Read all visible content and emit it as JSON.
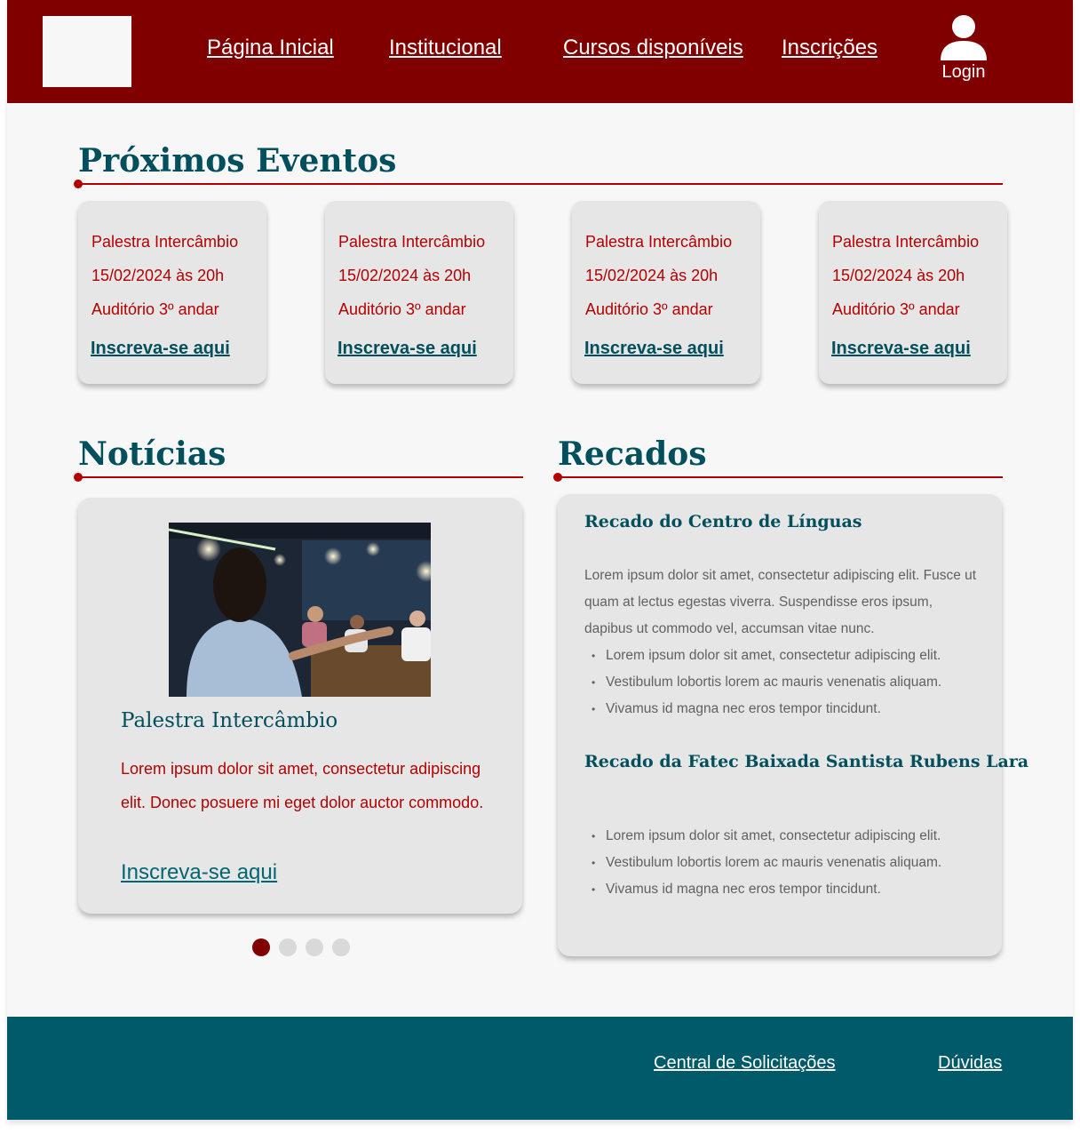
{
  "header": {
    "nav": [
      {
        "label": "Página Inicial"
      },
      {
        "label": "Institucional"
      },
      {
        "label": "Cursos disponíveis"
      },
      {
        "label": "Inscrições"
      }
    ],
    "login_label": "Login"
  },
  "events": {
    "title": "Próximos Eventos",
    "cards": [
      {
        "name": "Palestra Intercâmbio",
        "date": "15/02/2024 às 20h",
        "place": "Auditório 3º andar",
        "link": "Inscreva-se aqui"
      },
      {
        "name": "Palestra Intercâmbio",
        "date": "15/02/2024 às 20h",
        "place": "Auditório 3º andar",
        "link": "Inscreva-se aqui"
      },
      {
        "name": "Palestra Intercâmbio",
        "date": "15/02/2024 às 20h",
        "place": "Auditório 3º andar",
        "link": "Inscreva-se aqui"
      },
      {
        "name": "Palestra Intercâmbio",
        "date": "15/02/2024 às 20h",
        "place": "Auditório 3º andar",
        "link": "Inscreva-se aqui"
      }
    ]
  },
  "news": {
    "title": "Notícias",
    "item": {
      "headline": "Palestra Intercâmbio",
      "text": "Lorem ipsum dolor sit amet, consectetur adipiscing elit. Donec posuere mi eget dolor auctor commodo.",
      "link": "Inscreva-se aqui"
    },
    "carousel": {
      "count": 4,
      "active": 1
    }
  },
  "recados": {
    "title": "Recados",
    "items": [
      {
        "title": "Recado do Centro de Línguas",
        "text": "Lorem ipsum dolor sit amet, consectetur adipiscing elit. Fusce ut quam at lectus egestas viverra. Suspendisse eros ipsum, dapibus ut commodo vel, accumsan vitae nunc.",
        "bullets": [
          "Lorem ipsum dolor sit amet, consectetur adipiscing elit.",
          "Vestibulum lobortis lorem ac mauris venenatis aliquam.",
          "Vivamus id magna nec eros tempor tincidunt."
        ]
      },
      {
        "title": "Recado da Fatec Baixada Santista Rubens Lara",
        "text": "",
        "bullets": [
          "Lorem ipsum dolor sit amet, consectetur adipiscing elit.",
          "Vestibulum lobortis lorem ac mauris venenatis aliquam.",
          "Vivamus id magna nec eros tempor tincidunt."
        ]
      }
    ]
  },
  "footer": {
    "links": [
      {
        "label": "Central de Solicitações"
      },
      {
        "label": "Dúvidas"
      }
    ]
  },
  "colors": {
    "primary": "#800000",
    "accent_red": "#b30000",
    "teal": "#004f5c",
    "footer": "#005a6a",
    "card": "#e6e6e6",
    "background": "#f7f7f7"
  },
  "icons": {
    "login": "user-icon"
  }
}
